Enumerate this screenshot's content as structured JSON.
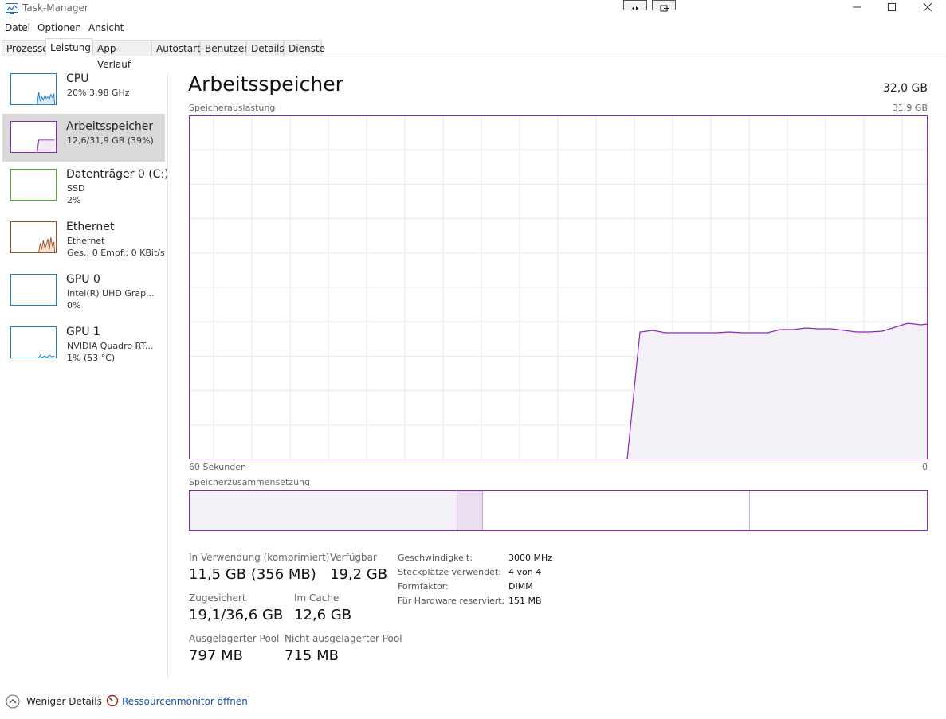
{
  "window": {
    "title": "Task-Manager"
  },
  "menu": {
    "items": [
      "Datei",
      "Optionen",
      "Ansicht"
    ]
  },
  "tabs": [
    "Prozesse",
    "Leistung",
    "App-Verlauf",
    "Autostart",
    "Benutzer",
    "Details",
    "Dienste"
  ],
  "active_tab": "Leistung",
  "sidebar": {
    "items": [
      {
        "title": "CPU",
        "sub1": "20%  3,98 GHz",
        "sub2": "",
        "color": "#1e7fc4",
        "icon": "cpu-graph-icon"
      },
      {
        "title": "Arbeitsspeicher",
        "sub1": "12,6/31,9 GB (39%)",
        "sub2": "",
        "color": "#8b27b8",
        "icon": "memory-graph-icon"
      },
      {
        "title": "Datenträger 0 (C:)",
        "sub1": "SSD",
        "sub2": "2%",
        "color": "#4caf1f",
        "icon": "disk-graph-icon"
      },
      {
        "title": "Ethernet",
        "sub1": "Ethernet",
        "sub2": "Ges.: 0  Empf.: 0 KBit/s",
        "color": "#a4501b",
        "icon": "ethernet-graph-icon"
      },
      {
        "title": "GPU 0",
        "sub1": "Intel(R) UHD Grap...",
        "sub2": "0%",
        "color": "#1e7fc4",
        "icon": "gpu-graph-icon"
      },
      {
        "title": "GPU 1",
        "sub1": "NVIDIA Quadro RT...",
        "sub2": "1%  (53 °C)",
        "color": "#1e7fc4",
        "icon": "gpu-graph-icon"
      }
    ]
  },
  "main": {
    "title": "Arbeitsspeicher",
    "total": "32,0 GB",
    "graph_label": "Speicherauslastung",
    "graph_max": "31,9 GB",
    "x_left": "60 Sekunden",
    "x_right": "0",
    "composition_label": "Speicherzusammensetzung",
    "stats": {
      "in_use_label": "In Verwendung (komprimiert)",
      "in_use_value": "11,5 GB (356 MB)",
      "available_label": "Verfügbar",
      "available_value": "19,2 GB",
      "committed_label": "Zugesichert",
      "committed_value": "19,1/36,6 GB",
      "cached_label": "Im Cache",
      "cached_value": "12,6 GB",
      "paged_label": "Ausgelagerter Pool",
      "paged_value": "797 MB",
      "nonpaged_label": "Nicht ausgelagerter Pool",
      "nonpaged_value": "715 MB"
    },
    "details": [
      {
        "label": "Geschwindigkeit:",
        "value": "3000 MHz"
      },
      {
        "label": "Steckplätze verwendet:",
        "value": "4 von 4"
      },
      {
        "label": "Formfaktor:",
        "value": "DIMM"
      },
      {
        "label": "Für Hardware reserviert:",
        "value": "151 MB"
      }
    ]
  },
  "footer": {
    "fewer_details": "Weniger Details",
    "resource_monitor": "Ressourcenmonitor öffnen"
  },
  "colors": {
    "memory_accent": "#8b27b8",
    "memory_fill": "#f4f0f7",
    "grid": "#e8e2ee"
  }
}
